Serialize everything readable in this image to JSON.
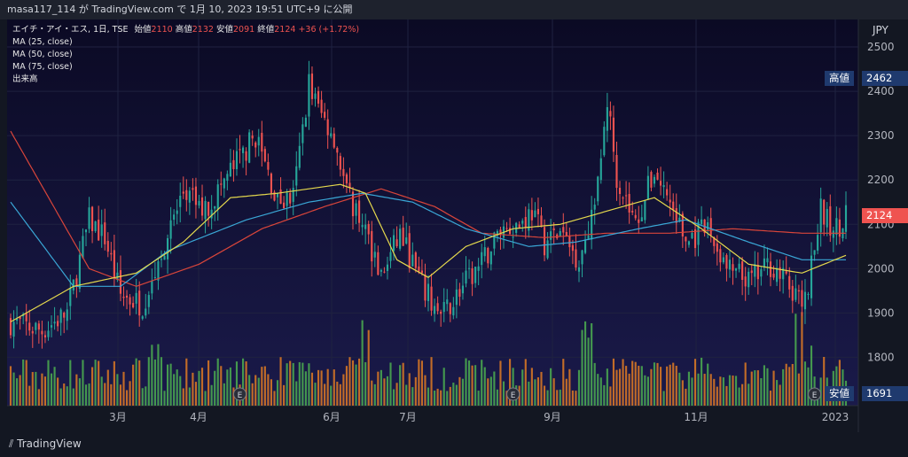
{
  "header": {
    "text": "masa117_114 が TradingView.com で 1月 10, 2023 19:51 UTC+9 に公開"
  },
  "legend": {
    "symbol": "エイチ・アイ・エス, 1日, TSE",
    "open_label": "始値",
    "open": "2110",
    "high_label": "高値",
    "high": "2132",
    "low_label": "安値",
    "low": "2091",
    "close_label": "終値",
    "close": "2124",
    "change": "+36 (+1.72%)",
    "ma25": "MA (25, close)",
    "ma50": "MA (50, close)",
    "ma75": "MA (75, close)",
    "volume": "出来高"
  },
  "price_scale": {
    "currency": "JPY",
    "ticks": [
      "2500",
      "2400",
      "2300",
      "2200",
      "2100",
      "2000",
      "1900",
      "1800"
    ],
    "high_label": "高値",
    "high_value": "2462",
    "last_value": "2124",
    "low_label": "安値",
    "low_value": "1691"
  },
  "time_axis": {
    "labels": [
      "3月",
      "4月",
      "6月",
      "7月",
      "9月",
      "11月",
      "2023"
    ]
  },
  "footer": {
    "brand": "TradingView"
  },
  "colors": {
    "up": "#26a69a",
    "down": "#ef5350",
    "ma25": "#e5d94d",
    "ma50": "#3aa7d6",
    "ma75": "#d8453a",
    "vol_up": "#4caf50",
    "vol_down": "#e07b23"
  },
  "chart_data": {
    "type": "candlestick",
    "ylim": [
      1691,
      2562
    ],
    "anchors": [
      {
        "x": 0,
        "p": 1880
      },
      {
        "x": 10,
        "p": 1860
      },
      {
        "x": 18,
        "p": 1900
      },
      {
        "x": 25,
        "p": 2110
      },
      {
        "x": 30,
        "p": 2070
      },
      {
        "x": 35,
        "p": 1940
      },
      {
        "x": 42,
        "p": 1920
      },
      {
        "x": 55,
        "p": 2170
      },
      {
        "x": 62,
        "p": 2130
      },
      {
        "x": 70,
        "p": 2220
      },
      {
        "x": 78,
        "p": 2300
      },
      {
        "x": 85,
        "p": 2150
      },
      {
        "x": 90,
        "p": 2160
      },
      {
        "x": 95,
        "p": 2420
      },
      {
        "x": 98,
        "p": 2360
      },
      {
        "x": 103,
        "p": 2300
      },
      {
        "x": 107,
        "p": 2170
      },
      {
        "x": 112,
        "p": 2110
      },
      {
        "x": 118,
        "p": 1980
      },
      {
        "x": 124,
        "p": 2080
      },
      {
        "x": 131,
        "p": 1960
      },
      {
        "x": 137,
        "p": 1890
      },
      {
        "x": 143,
        "p": 1950
      },
      {
        "x": 150,
        "p": 2010
      },
      {
        "x": 156,
        "p": 2090
      },
      {
        "x": 162,
        "p": 2100
      },
      {
        "x": 166,
        "p": 2130
      },
      {
        "x": 170,
        "p": 2060
      },
      {
        "x": 175,
        "p": 2080
      },
      {
        "x": 181,
        "p": 2020
      },
      {
        "x": 187,
        "p": 2180
      },
      {
        "x": 190,
        "p": 2380
      },
      {
        "x": 193,
        "p": 2210
      },
      {
        "x": 199,
        "p": 2100
      },
      {
        "x": 205,
        "p": 2220
      },
      {
        "x": 210,
        "p": 2150
      },
      {
        "x": 215,
        "p": 2060
      },
      {
        "x": 222,
        "p": 2090
      },
      {
        "x": 228,
        "p": 2000
      },
      {
        "x": 235,
        "p": 1970
      },
      {
        "x": 242,
        "p": 2010
      },
      {
        "x": 248,
        "p": 1960
      },
      {
        "x": 253,
        "p": 1920
      },
      {
        "x": 258,
        "p": 2130
      },
      {
        "x": 262,
        "p": 2080
      },
      {
        "x": 266,
        "p": 2124
      }
    ],
    "ma25": [
      [
        0,
        1880
      ],
      [
        20,
        1960
      ],
      [
        40,
        1990
      ],
      [
        55,
        2060
      ],
      [
        70,
        2160
      ],
      [
        85,
        2170
      ],
      [
        105,
        2190
      ],
      [
        113,
        2170
      ],
      [
        123,
        2020
      ],
      [
        133,
        1980
      ],
      [
        145,
        2050
      ],
      [
        160,
        2090
      ],
      [
        175,
        2100
      ],
      [
        190,
        2130
      ],
      [
        205,
        2160
      ],
      [
        220,
        2090
      ],
      [
        235,
        2010
      ],
      [
        252,
        1990
      ],
      [
        266,
        2030
      ]
    ],
    "ma50": [
      [
        0,
        2150
      ],
      [
        20,
        1960
      ],
      [
        35,
        1960
      ],
      [
        50,
        2040
      ],
      [
        75,
        2110
      ],
      [
        95,
        2150
      ],
      [
        112,
        2170
      ],
      [
        128,
        2150
      ],
      [
        145,
        2090
      ],
      [
        165,
        2050
      ],
      [
        180,
        2060
      ],
      [
        200,
        2090
      ],
      [
        215,
        2110
      ],
      [
        235,
        2060
      ],
      [
        252,
        2020
      ],
      [
        266,
        2020
      ]
    ],
    "ma75": [
      [
        0,
        2310
      ],
      [
        25,
        2000
      ],
      [
        40,
        1960
      ],
      [
        60,
        2010
      ],
      [
        80,
        2090
      ],
      [
        100,
        2140
      ],
      [
        118,
        2180
      ],
      [
        135,
        2140
      ],
      [
        150,
        2080
      ],
      [
        170,
        2070
      ],
      [
        190,
        2080
      ],
      [
        210,
        2080
      ],
      [
        230,
        2090
      ],
      [
        252,
        2080
      ],
      [
        266,
        2080
      ]
    ],
    "volume_spikes": [
      45,
      47,
      112,
      114,
      182,
      183,
      184,
      185,
      250,
      252,
      255
    ]
  }
}
